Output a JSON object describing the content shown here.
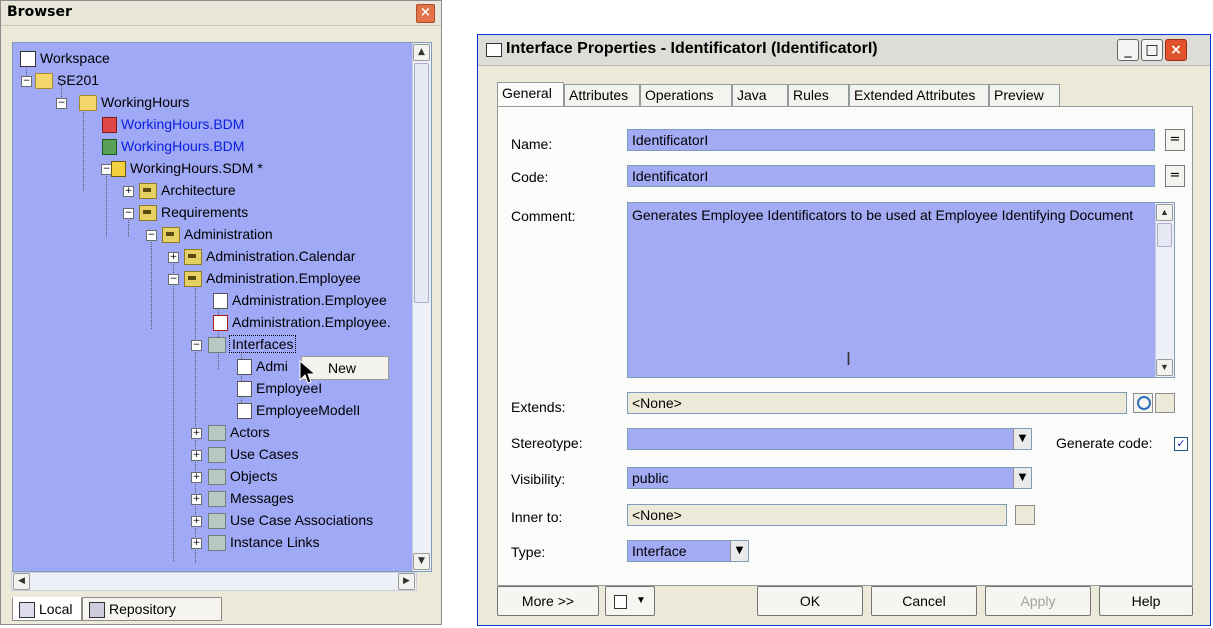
{
  "browser": {
    "title": "Browser",
    "tree": [
      {
        "label": "Workspace",
        "icon": "workspace-icon",
        "color": "default"
      },
      {
        "label": "SE201",
        "icon": "folder-icon",
        "color": "default"
      },
      {
        "label": "WorkingHours",
        "icon": "folder-icon",
        "color": "default"
      },
      {
        "label": "WorkingHours.BDM",
        "icon": "bdm-model-icon",
        "color": "blue"
      },
      {
        "label": "WorkingHours.BDM",
        "icon": "bdm-model-icon",
        "color": "blue"
      },
      {
        "label": "WorkingHours.SDM *",
        "icon": "sdm-model-icon",
        "color": "default"
      },
      {
        "label": "Architecture",
        "icon": "package-icon",
        "color": "default"
      },
      {
        "label": "Requirements",
        "icon": "package-icon",
        "color": "default"
      },
      {
        "label": "Administration",
        "icon": "package-icon",
        "color": "default"
      },
      {
        "label": "Administration.Calendar",
        "icon": "package-icon",
        "color": "default"
      },
      {
        "label": "Administration.Employee",
        "icon": "package-icon",
        "color": "default"
      },
      {
        "label": "Administration.Employee",
        "icon": "diagram-icon",
        "color": "default"
      },
      {
        "label": "Administration.Employee.",
        "icon": "diagram-icon",
        "color": "default"
      },
      {
        "label": "Interfaces",
        "icon": "folder-icon",
        "color": "default"
      },
      {
        "label": "Admi",
        "icon": "interface-icon",
        "color": "default"
      },
      {
        "label": "EmployeeI",
        "icon": "interface-icon",
        "color": "default"
      },
      {
        "label": "EmployeeModelI",
        "icon": "interface-icon",
        "color": "default"
      },
      {
        "label": "Actors",
        "icon": "folder-icon",
        "color": "default"
      },
      {
        "label": "Use Cases",
        "icon": "folder-icon",
        "color": "default"
      },
      {
        "label": "Objects",
        "icon": "folder-icon",
        "color": "default"
      },
      {
        "label": "Messages",
        "icon": "folder-icon",
        "color": "default"
      },
      {
        "label": "Use Case Associations",
        "icon": "folder-icon",
        "color": "default"
      },
      {
        "label": "Instance Links",
        "icon": "folder-icon",
        "color": "default"
      }
    ],
    "context_menu": {
      "item": "New"
    },
    "tabs": [
      "Local",
      "Repository"
    ]
  },
  "dialog": {
    "title": "Interface Properties - IdentificatorI (IdentificatorI)",
    "tabs": [
      "General",
      "Attributes",
      "Operations",
      "Java",
      "Rules",
      "Extended Attributes",
      "Preview"
    ],
    "labels": {
      "name": "Name:",
      "code": "Code:",
      "comment": "Comment:",
      "extends": "Extends:",
      "stereotype": "Stereotype:",
      "visibility": "Visibility:",
      "inner_to": "Inner to:",
      "type": "Type:",
      "generate_code": "Generate code:"
    },
    "values": {
      "name": "IdentificatorI",
      "code": "IdentificatorI",
      "comment": "Generates Employee Identificators to be used at Employee Identifying Document",
      "extends": "<None>",
      "stereotype": "",
      "visibility": "public",
      "inner_to": "<None>",
      "type": "Interface",
      "generate_code": true
    },
    "eq_button": "=",
    "buttons": {
      "more": "More >>",
      "ok": "OK",
      "cancel": "Cancel",
      "apply": "Apply",
      "help": "Help"
    }
  }
}
